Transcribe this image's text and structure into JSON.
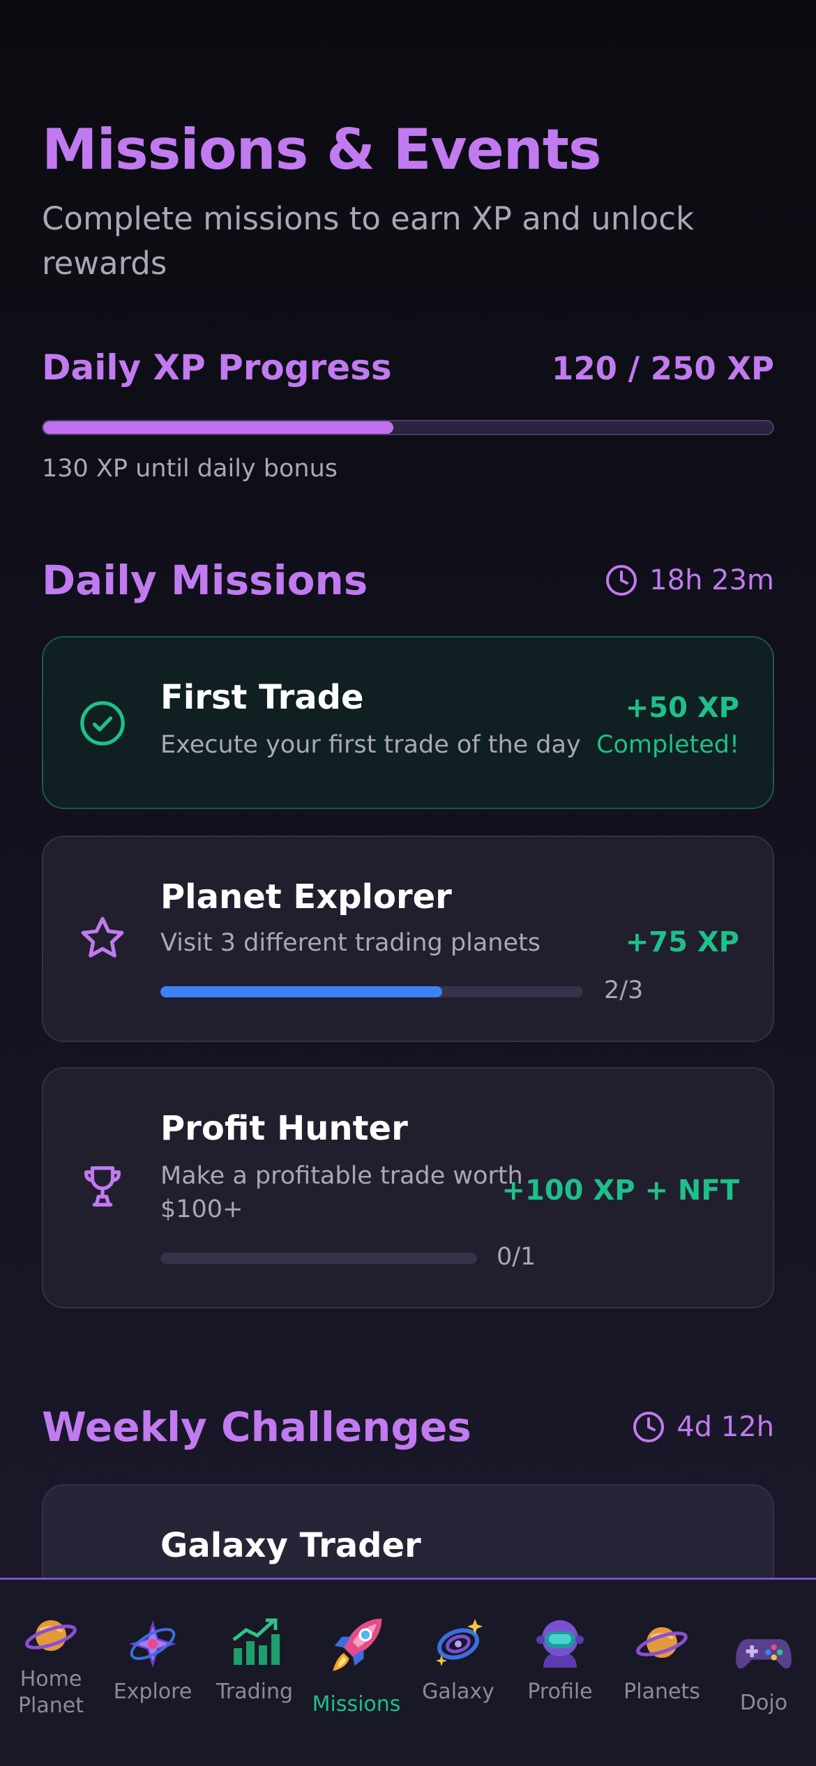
{
  "header": {
    "title": "Missions & Events",
    "subtitle": "Complete missions to earn XP and unlock rewards"
  },
  "daily_xp": {
    "title": "Daily XP Progress",
    "value": "120 / 250 XP",
    "progress": 0.48,
    "note": "130 XP until daily bonus"
  },
  "daily_missions": {
    "title": "Daily Missions",
    "timer": "18h 23m",
    "missions": [
      {
        "icon": "check-circle-icon",
        "title": "First Trade",
        "description": "Execute your first trade of the day",
        "reward": "+50 XP",
        "status": "Completed!"
      },
      {
        "icon": "star-icon",
        "title": "Planet Explorer",
        "description": "Visit 3 different trading planets",
        "reward": "+75 XP",
        "progress": 0.667,
        "count": "2/3"
      },
      {
        "icon": "trophy-icon",
        "title": "Profit Hunter",
        "description": "Make a profitable trade worth $100+",
        "reward": "+100 XP + NFT",
        "progress": 0,
        "count": "0/1"
      }
    ]
  },
  "weekly_challenges": {
    "title": "Weekly Challenges",
    "timer": "4d 12h",
    "challenges": [
      {
        "title": "Galaxy Trader"
      }
    ]
  },
  "nav": {
    "items": [
      {
        "label": "Home Planet",
        "icon": "ringed-planet-icon"
      },
      {
        "label": "Explore",
        "icon": "compass-star-icon"
      },
      {
        "label": "Trading",
        "icon": "chart-up-icon"
      },
      {
        "label": "Missions",
        "icon": "rocket-icon",
        "active": true
      },
      {
        "label": "Galaxy",
        "icon": "galaxy-icon"
      },
      {
        "label": "Profile",
        "icon": "astronaut-icon"
      },
      {
        "label": "Planets",
        "icon": "ringed-planet-icon"
      },
      {
        "label": "Dojo",
        "icon": "gamepad-icon"
      }
    ]
  },
  "colors": {
    "accent": "#c17af0",
    "success": "#1fbf8a",
    "progress_blue": "#3b82f6",
    "nav_border": "#7a4fd1"
  }
}
